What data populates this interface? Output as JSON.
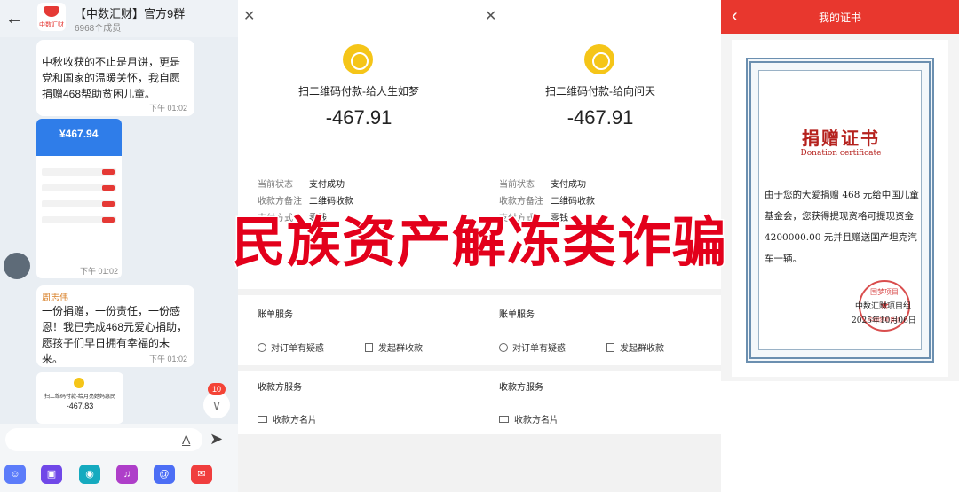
{
  "chat": {
    "title": "【中数汇财】官方9群",
    "member_count": "6968个成员",
    "group_logo_text": "中数汇财",
    "messages": [
      {
        "text": "中秋收获的不止是月饼，更是党和国家的温暖关怀，我自愿捐赠468帮助贫困儿童。",
        "time": "下午 01:02"
      },
      {
        "type": "screenshot",
        "amount": "¥467.94",
        "time": "下午 01:02"
      },
      {
        "sender": "周志伟",
        "text": "一份捐赠，一份责任，一份感恩！我已完成468元爱心捐助，愿孩子们早日拥有幸福的未来。",
        "time": "下午 01:02"
      },
      {
        "type": "payment_card",
        "title": "扫二维码付款-给月亮她妈惠民",
        "amount": "-467.83"
      }
    ],
    "unread_badge": "10",
    "input_placeholder": "",
    "toolbar": [
      {
        "icon": "emoji-icon",
        "color": "#5c7cfa"
      },
      {
        "icon": "image-icon",
        "color": "#7048e8"
      },
      {
        "icon": "camera-icon",
        "color": "#15aabf"
      },
      {
        "icon": "voice-icon",
        "color": "#ae3ec9"
      },
      {
        "icon": "mention-icon",
        "color": "#4c6ef5"
      },
      {
        "icon": "redpacket-icon",
        "color": "#f03e3e"
      }
    ]
  },
  "payment_left": {
    "title": "扫二维码付款-给人生如梦",
    "amount": "-467.91",
    "rows": [
      {
        "label": "当前状态",
        "value": "支付成功"
      },
      {
        "label": "收款方备注",
        "value": "二维码收款"
      },
      {
        "label": "支付方式",
        "value": "零钱"
      }
    ],
    "bill_service": "账单服务",
    "service_doubt": "对订单有疑惑",
    "service_group": "发起群收款",
    "payee_service": "收款方服务",
    "payee_card": "收款方名片"
  },
  "payment_right": {
    "title": "扫二维码付款-给向问天",
    "amount": "-467.91",
    "rows": [
      {
        "label": "当前状态",
        "value": "支付成功"
      },
      {
        "label": "收款方备注",
        "value": "二维码收款"
      },
      {
        "label": "支付方式",
        "value": "零钱"
      }
    ],
    "bill_service": "账单服务",
    "service_doubt": "对订单有疑惑",
    "service_group": "发起群收款",
    "payee_service": "收款方服务",
    "payee_card": "收款方名片"
  },
  "certificate": {
    "page_title": "我的证书",
    "heading": "捐赠证书",
    "subheading": "Donation certificate",
    "body": "由于您的大爱捐赠 468 元给中国儿童基金会，您获得提现资格可提现资金 4200000.00 元并且赠送国产坦克汽车一辆。",
    "org": "中数汇财项目组",
    "date": "2025年10月06日",
    "seal_top": "国梦项目",
    "seal_bottom": "中国梦项目组"
  },
  "overlay_text": "民族资产解冻类诈骗",
  "colors": {
    "accent_red": "#e3001b",
    "cert_red": "#b5211d",
    "header_red": "#e8372e",
    "coin_yellow": "#f5c518",
    "chat_bg": "#e9eef3"
  }
}
